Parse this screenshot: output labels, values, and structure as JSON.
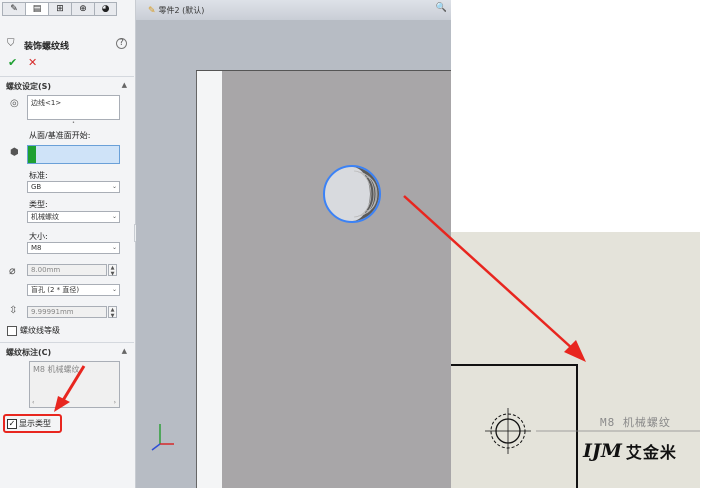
{
  "tabs": [
    {
      "name": "feature-manager",
      "icon": "✎"
    },
    {
      "name": "property-manager",
      "icon": "▤"
    },
    {
      "name": "configuration-manager",
      "icon": "⊞"
    },
    {
      "name": "dimxpert-manager",
      "icon": "⊕"
    },
    {
      "name": "display-manager",
      "icon": "◕"
    }
  ],
  "header": {
    "title": "装饰螺纹线",
    "help": "?",
    "ok": "✔",
    "cancel": "✕"
  },
  "thread_settings": {
    "title": "螺纹设定(S)",
    "edge_value": "边线<1>",
    "from_label": "从面/基准面开始:",
    "standard_label": "标准:",
    "standard_value": "GB",
    "type_label": "类型:",
    "type_value": "机械螺纹",
    "size_label": "大小:",
    "size_value": "M8",
    "diameter_value": "8.00mm",
    "end_condition_value": "盲孔 (2 * 直径)",
    "depth_value": "9.99991mm",
    "thread_class_label": "螺纹线等级"
  },
  "callout": {
    "title": "螺纹标注(C)",
    "text": "M8 机械螺纹",
    "show_type_label": "显示类型",
    "show_type_checked": true
  },
  "viewport": {
    "breadcrumb": "零件2 (默认)"
  },
  "inset": {
    "callout_text": "M8 机械螺纹",
    "logo_mark": "IJM",
    "logo_text": "艾金米"
  },
  "colors": {
    "accent_green": "#1ea032",
    "cancel_red": "#d62a2a",
    "arrow_red": "#e8261f",
    "highlight_blue": "#3b82f6"
  }
}
